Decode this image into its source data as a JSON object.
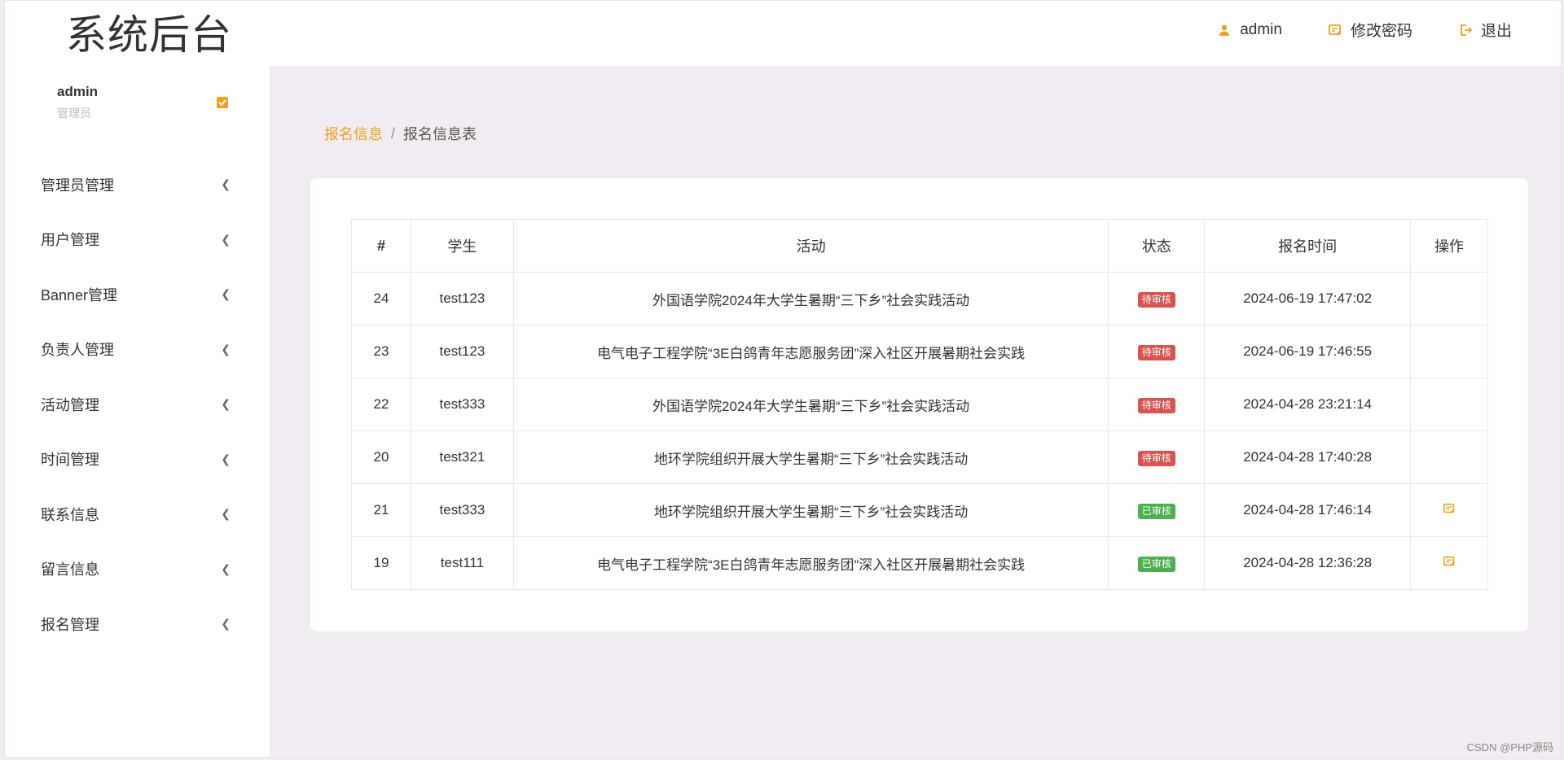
{
  "header": {
    "brand": "系统后台",
    "user_label": "admin",
    "change_password_label": "修改密码",
    "logout_label": "退出"
  },
  "sidebar": {
    "profile_name": "admin",
    "profile_role": "管理员",
    "items": [
      {
        "label": "管理员管理"
      },
      {
        "label": "用户管理"
      },
      {
        "label": "Banner管理"
      },
      {
        "label": "负责人管理"
      },
      {
        "label": "活动管理"
      },
      {
        "label": "时间管理"
      },
      {
        "label": "联系信息"
      },
      {
        "label": "留言信息"
      },
      {
        "label": "报名管理"
      }
    ]
  },
  "breadcrumb": {
    "root": "报名信息",
    "separator": "/",
    "current": "报名信息表"
  },
  "table": {
    "headers": [
      "#",
      "学生",
      "活动",
      "状态",
      "报名时间",
      "操作"
    ],
    "rows": [
      {
        "id": "24",
        "student": "test123",
        "activity": "外国语学院2024年大学生暑期“三下乡”社会实践活动",
        "status": "待审核",
        "time": "2024-06-19 17:47:02"
      },
      {
        "id": "23",
        "student": "test123",
        "activity": "电气电子工程学院“3E白鸽青年志愿服务团”深入社区开展暑期社会实践",
        "status": "待审核",
        "time": "2024-06-19 17:46:55"
      },
      {
        "id": "22",
        "student": "test333",
        "activity": "外国语学院2024年大学生暑期“三下乡”社会实践活动",
        "status": "待审核",
        "time": "2024-04-28 23:21:14"
      },
      {
        "id": "20",
        "student": "test321",
        "activity": "地环学院组织开展大学生暑期“三下乡”社会实践活动",
        "status": "待审核",
        "time": "2024-04-28 17:40:28"
      },
      {
        "id": "21",
        "student": "test333",
        "activity": "地环学院组织开展大学生暑期“三下乡”社会实践活动",
        "status": "已审核",
        "time": "2024-04-28 17:46:14"
      },
      {
        "id": "19",
        "student": "test111",
        "activity": "电气电子工程学院“3E白鸽青年志愿服务团”深入社区开展暑期社会实践",
        "status": "已审核",
        "time": "2024-04-28 12:36:28"
      }
    ]
  },
  "watermark": "CSDN @PHP源码",
  "colors": {
    "accent": "#f0a01f",
    "pending": "#d9534f",
    "approved": "#4cb050",
    "content_bg": "#f1ecf1"
  }
}
